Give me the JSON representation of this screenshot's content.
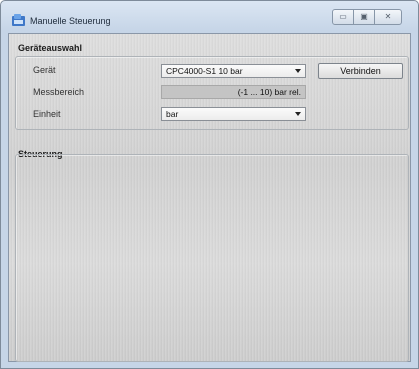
{
  "window": {
    "title": "Manuelle Steuerung",
    "controls": {
      "minimize": "▭",
      "restore": "▣",
      "close": "✕"
    }
  },
  "device_selection": {
    "group_title": "Geräteauswahl",
    "device_label": "Gerät",
    "device_value": "CPC4000-S1 10 bar",
    "connect_button": "Verbinden",
    "range_label": "Messbereich",
    "range_value": "(-1 ... 10) bar rel.",
    "unit_label": "Einheit",
    "unit_value": "bar"
  },
  "control": {
    "group_title": "Steuerung"
  },
  "colors": {
    "title_bar": "#c6d5e7",
    "client_bg": "#d4d4d4",
    "readout_bg": "#c4c4c4"
  }
}
